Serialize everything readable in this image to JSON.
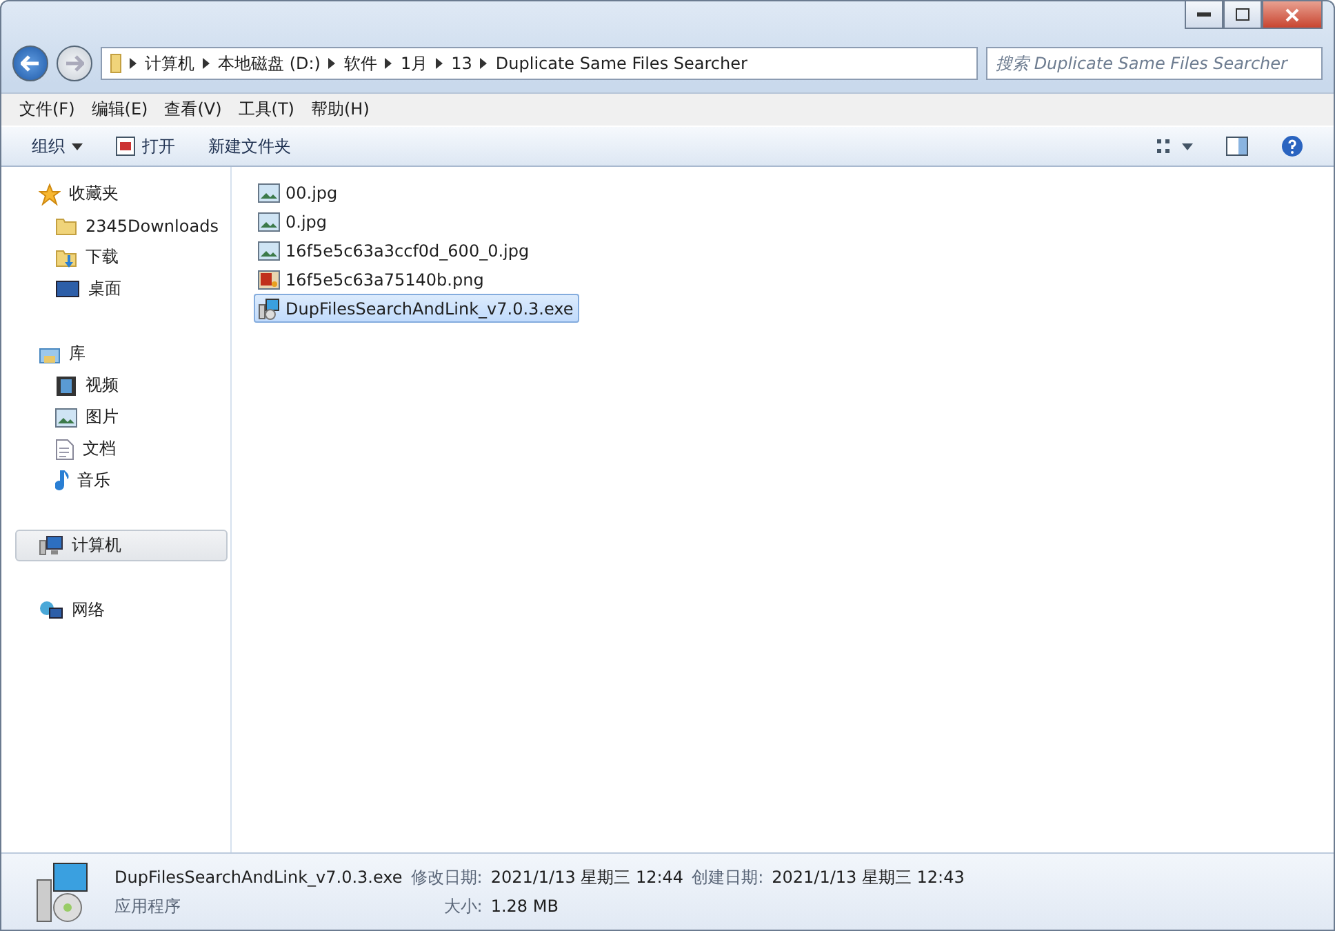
{
  "address_bar": {
    "crumbs": [
      "计算机",
      "本地磁盘 (D:)",
      "软件",
      "1月",
      "13",
      "Duplicate Same Files Searcher"
    ]
  },
  "search": {
    "placeholder": "搜索 Duplicate Same Files Searcher"
  },
  "menu_bar": [
    "文件(F)",
    "编辑(E)",
    "查看(V)",
    "工具(T)",
    "帮助(H)"
  ],
  "toolbar": [
    {
      "label": "组织",
      "kind": "dropdown"
    },
    {
      "label": "打开",
      "kind": "open"
    },
    {
      "label": "新建文件夹",
      "kind": "plain"
    }
  ],
  "sidebar": [
    {
      "label": "收藏夹",
      "selected": false,
      "children": [
        {
          "label": "2345Downloads",
          "selected": false
        },
        {
          "label": "下载",
          "selected": false
        },
        {
          "label": "桌面",
          "selected": false
        }
      ]
    },
    {
      "label": "库",
      "selected": false,
      "children": [
        {
          "label": "视频",
          "selected": false
        },
        {
          "label": "图片",
          "selected": false
        },
        {
          "label": "文档",
          "selected": false
        },
        {
          "label": "音乐",
          "selected": false
        }
      ]
    },
    {
      "label": "计算机",
      "selected": true
    },
    {
      "label": "网络",
      "selected": false
    }
  ],
  "files": [
    {
      "name": "00.jpg",
      "kind": "image",
      "selected": false
    },
    {
      "name": "0.jpg",
      "kind": "image",
      "selected": false
    },
    {
      "name": "16f5e5c63a3ccf0d_600_0.jpg",
      "kind": "image",
      "selected": false
    },
    {
      "name": "16f5e5c63a75140b.png",
      "kind": "png",
      "selected": false
    },
    {
      "name": "DupFilesSearchAndLink_v7.0.3.exe",
      "kind": "installer",
      "selected": true
    }
  ],
  "details": {
    "name": "DupFilesSearchAndLink_v7.0.3.exe",
    "type": "应用程序",
    "modified_label": "修改日期:",
    "modified": "2021/1/13 星期三 12:44",
    "created_label": "创建日期:",
    "created": "2021/1/13 星期三 12:43",
    "size_label": "大小:",
    "size": "1.28 MB"
  }
}
